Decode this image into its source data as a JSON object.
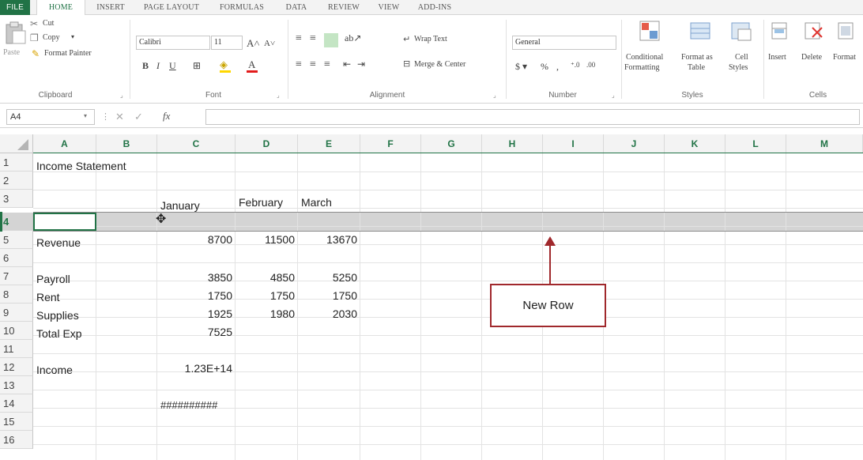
{
  "ribbon_tabs": [
    "FILE",
    "HOME",
    "INSERT",
    "PAGE LAYOUT",
    "FORMULAS",
    "DATA",
    "REVIEW",
    "VIEW",
    "ADD-INS"
  ],
  "clipboard": {
    "paste": "Paste",
    "cut": "Cut",
    "copy": "Copy",
    "format_painter": "Format Painter",
    "group_label": "Clipboard"
  },
  "font": {
    "name": "Calibri",
    "size": "11",
    "group_label": "Font"
  },
  "alignment": {
    "wrap_text": "Wrap Text",
    "merge_center": "Merge & Center",
    "group_label": "Alignment"
  },
  "number": {
    "format": "General",
    "group_label": "Number"
  },
  "styles": {
    "conditional_formatting_1": "Conditional",
    "conditional_formatting_2": "Formatting",
    "format_as_table_1": "Format as",
    "format_as_table_2": "Table",
    "cell_styles_1": "Cell",
    "cell_styles_2": "Styles",
    "group_label": "Styles"
  },
  "cells": {
    "insert": "Insert",
    "delete": "Delete",
    "format": "Format",
    "group_label": "Cells"
  },
  "formula_bar": {
    "name_box": "A4",
    "fx": "fx",
    "value": ""
  },
  "columns": [
    "A",
    "B",
    "C",
    "D",
    "E",
    "F",
    "G",
    "H",
    "I",
    "J",
    "K",
    "L",
    "M"
  ],
  "rows": [
    "1",
    "2",
    "3",
    "4",
    "5",
    "6",
    "7",
    "8",
    "9",
    "10",
    "11",
    "12",
    "13",
    "14",
    "15",
    "16"
  ],
  "sheet": {
    "a1": "Income Statement",
    "c3": "January",
    "d3": "February",
    "e3": "March",
    "a5": "Revenue",
    "c5": "8700",
    "d5": "11500",
    "e5": "13670",
    "a7": "Payroll",
    "c7": "3850",
    "d7": "4850",
    "e7": "5250",
    "a8": "Rent",
    "c8": "1750",
    "d8": "1750",
    "e8": "1750",
    "a9": "Supplies",
    "c9": "1925",
    "d9": "1980",
    "e9": "2030",
    "a10": "Total Exp",
    "c10": "7525",
    "a12": "Income",
    "c12": "1.23E+14",
    "c14": "##########"
  },
  "annotation": {
    "label": "New Row",
    "color": "#a0282c"
  },
  "colors": {
    "excel_green": "#217346",
    "selected_row": "#d4d4d4"
  }
}
